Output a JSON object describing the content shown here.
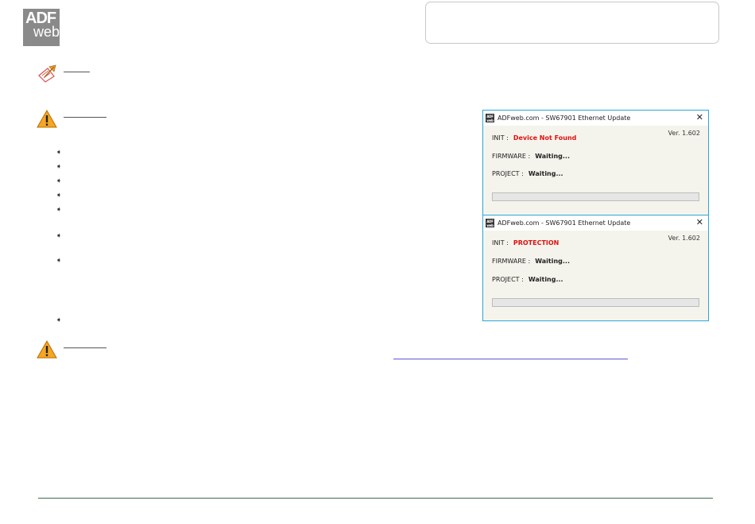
{
  "header": {
    "logo": {
      "line1": "ADF",
      "line2": "web"
    }
  },
  "sections": [
    {
      "icon": "note-pencil-icon"
    },
    {
      "icon": "warning-triangle-icon"
    },
    {
      "icon": "warning-triangle-icon"
    }
  ],
  "bullets": [
    "arrow-bullet",
    "arrow-bullet",
    "arrow-bullet",
    "arrow-bullet",
    "arrow-bullet",
    "arrow-bullet",
    "arrow-bullet",
    "arrow-bullet"
  ],
  "dialogs": [
    {
      "title": "ADFweb.com - SW67901 Ethernet Update",
      "version": "Ver. 1.602",
      "init_label": "INIT :",
      "init_value": "Device Not Found",
      "firmware_label": "FIRMWARE :",
      "firmware_value": "Waiting...",
      "project_label": "PROJECT :",
      "project_value": "Waiting...",
      "progress": 0
    },
    {
      "title": "ADFweb.com - SW67901 Ethernet Update",
      "version": "Ver. 1.602",
      "init_label": "INIT :",
      "init_value": "PROTECTION",
      "firmware_label": "FIRMWARE :",
      "firmware_value": "Waiting...",
      "project_label": "PROJECT :",
      "project_value": "Waiting...",
      "progress": 0
    }
  ],
  "colors": {
    "error_text": "#e01010",
    "window_border": "#2aa7dc",
    "footer_rule": "#3b6d4c",
    "warning_fill": "#f5a623"
  }
}
